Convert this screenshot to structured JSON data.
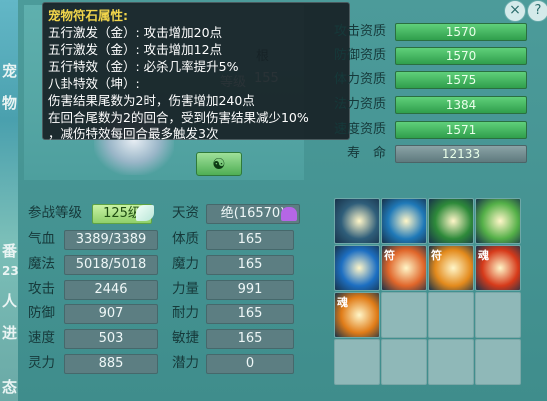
{
  "background": {
    "world_text": [
      "宠",
      "物",
      "23",
      "番",
      "人",
      "进",
      "态"
    ]
  },
  "window": {
    "close_label": "×",
    "help_label": "?"
  },
  "pet_area": {
    "hidden_level_label": "等级",
    "hidden_level_value": "155",
    "hidden_partial": "根",
    "yin_yang_icon": "☯"
  },
  "tooltip": {
    "title": "宠物符石属性:",
    "lines": [
      "五行激发（金）: 攻击增加20点",
      "五行激发（金）: 攻击增加12点",
      "五行特效（金）: 必杀几率提升5%",
      "八卦特效（坤）:",
      "伤害结果尾数为2时，伤害增加240点",
      "在回合尾数为2的回合，受到伤害结果减少10%",
      "，减伤特效每回合最多触发3次"
    ]
  },
  "aptitudes": [
    {
      "label": "攻击资质",
      "value": "1570"
    },
    {
      "label": "防御资质",
      "value": "1570"
    },
    {
      "label": "体力资质",
      "value": "1575"
    },
    {
      "label": "法力资质",
      "value": "1384"
    },
    {
      "label": "速度资质",
      "value": "1571"
    },
    {
      "label": "寿　命",
      "value": "12133"
    }
  ],
  "stats": {
    "level_label": "参战等级",
    "level_value": "125级",
    "talent_label": "天资",
    "talent_value": "绝(16570)",
    "left": [
      {
        "label": "气血",
        "value": "3389/3389"
      },
      {
        "label": "魔法",
        "value": "5018/5018"
      },
      {
        "label": "攻击",
        "value": "2446"
      },
      {
        "label": "防御",
        "value": "907"
      },
      {
        "label": "速度",
        "value": "503"
      },
      {
        "label": "灵力",
        "value": "885"
      }
    ],
    "right": [
      {
        "label": "体质",
        "value": "165"
      },
      {
        "label": "魔力",
        "value": "165"
      },
      {
        "label": "力量",
        "value": "991"
      },
      {
        "label": "耐力",
        "value": "165"
      },
      {
        "label": "敏捷",
        "value": "165"
      },
      {
        "label": "潜力",
        "value": "0"
      }
    ]
  },
  "skills": [
    {
      "icon": "frog-skill-icon",
      "glyph": "",
      "color": "#2f5e7a"
    },
    {
      "icon": "blue-light-skill-icon",
      "glyph": "",
      "color": "#1f79b8"
    },
    {
      "icon": "flying-kick-skill-icon",
      "glyph": "",
      "color": "#2e8a3a"
    },
    {
      "icon": "green-heart-skill-icon",
      "glyph": "",
      "color": "#54b048"
    },
    {
      "icon": "water-swirl-skill-icon",
      "glyph": "",
      "color": "#1d6fc2"
    },
    {
      "icon": "fire-sword-skill-icon",
      "glyph": "符",
      "color": "#e0662a"
    },
    {
      "icon": "strike-skill-icon",
      "glyph": "符",
      "color": "#e38a1c"
    },
    {
      "icon": "soul-skill-icon",
      "glyph": "魂",
      "color": "#d63a1a"
    },
    {
      "icon": "soul-blade-skill-icon",
      "glyph": "魂",
      "color": "#e07c18"
    },
    {
      "icon": "",
      "glyph": "",
      "color": ""
    },
    {
      "icon": "",
      "glyph": "",
      "color": ""
    },
    {
      "icon": "",
      "glyph": "",
      "color": ""
    },
    {
      "icon": "",
      "glyph": "",
      "color": ""
    },
    {
      "icon": "",
      "glyph": "",
      "color": ""
    },
    {
      "icon": "",
      "glyph": "",
      "color": ""
    },
    {
      "icon": "",
      "glyph": "",
      "color": ""
    }
  ],
  "colors": {
    "panel": "#3f8d8c",
    "tooltip_title": "#f2d64b",
    "aptitude_bar": "#2f9e4c",
    "value_box": "#5c7e82"
  }
}
